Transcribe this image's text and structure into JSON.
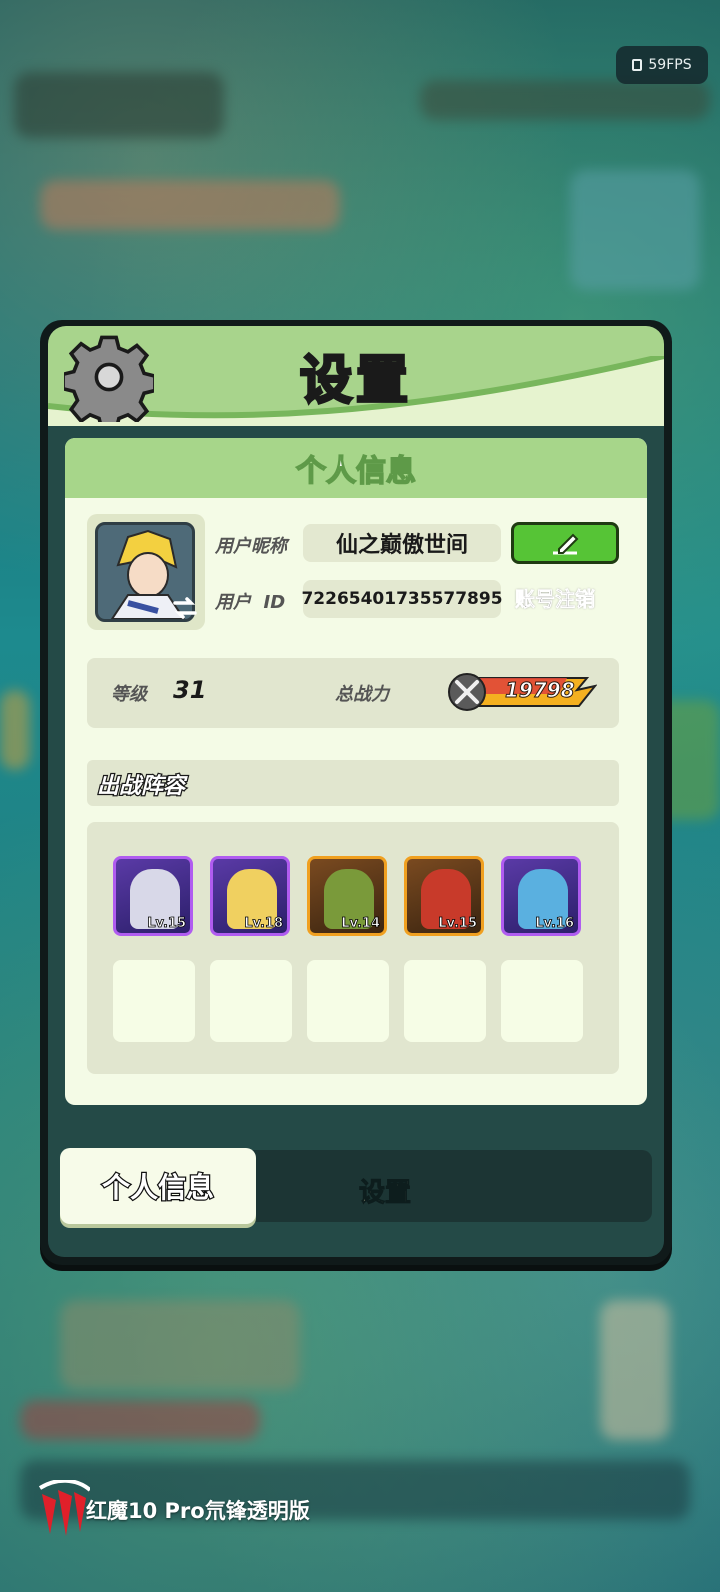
{
  "overlay": {
    "fps": "59FPS"
  },
  "dialog": {
    "title": "设置",
    "section_title": "个人信息",
    "profile": {
      "nickname_label": "用户昵称",
      "nickname": "仙之巅傲世间",
      "id_label": "用户  ID",
      "user_id": "72265401735577895",
      "cancel_account": "账号注销"
    },
    "stats": {
      "level_label": "等级",
      "level": "31",
      "power_label": "总战力",
      "power": "19798"
    },
    "lineup": {
      "title": "出战阵容",
      "heroes": [
        {
          "level": "Lv.15",
          "rarity": "purple",
          "color": "#d8d8e8"
        },
        {
          "level": "Lv.18",
          "rarity": "purple",
          "color": "#f0d060"
        },
        {
          "level": "Lv.14",
          "rarity": "orange",
          "color": "#7a9a3a"
        },
        {
          "level": "Lv.15",
          "rarity": "orange",
          "color": "#c83a2a"
        },
        {
          "level": "Lv.16",
          "rarity": "purple",
          "color": "#5ab0e0"
        }
      ],
      "empty_slots": 5
    },
    "tabs": [
      {
        "label": "个人信息",
        "active": true
      },
      {
        "label": "设置",
        "active": false
      }
    ]
  },
  "watermark": {
    "text": "红魔10 Pro氘锋透明版"
  }
}
